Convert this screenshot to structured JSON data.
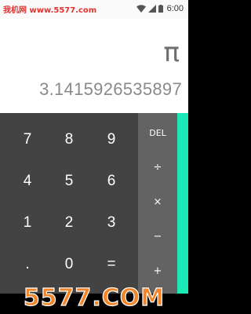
{
  "status_bar": {
    "watermark_text": "我机网 www.5577.com",
    "time": "6:00",
    "icons": [
      "wifi-icon",
      "signal-icon",
      "battery-icon"
    ]
  },
  "display": {
    "formula": "π",
    "result": "3.1415926535897"
  },
  "keypad": {
    "rows": [
      [
        "7",
        "8",
        "9"
      ],
      [
        "4",
        "5",
        "6"
      ],
      [
        "1",
        "2",
        "3"
      ],
      [
        ".",
        "0",
        "="
      ]
    ]
  },
  "operators": {
    "delete": "DEL",
    "divide": "÷",
    "multiply": "×",
    "subtract": "−",
    "add": "+"
  },
  "watermark_bottom": "5577.COM",
  "colors": {
    "keypad_bg": "#434343",
    "operator_bg": "#636363",
    "advanced_pad_accent": "#1de9b6",
    "display_bg": "#ffffff"
  }
}
